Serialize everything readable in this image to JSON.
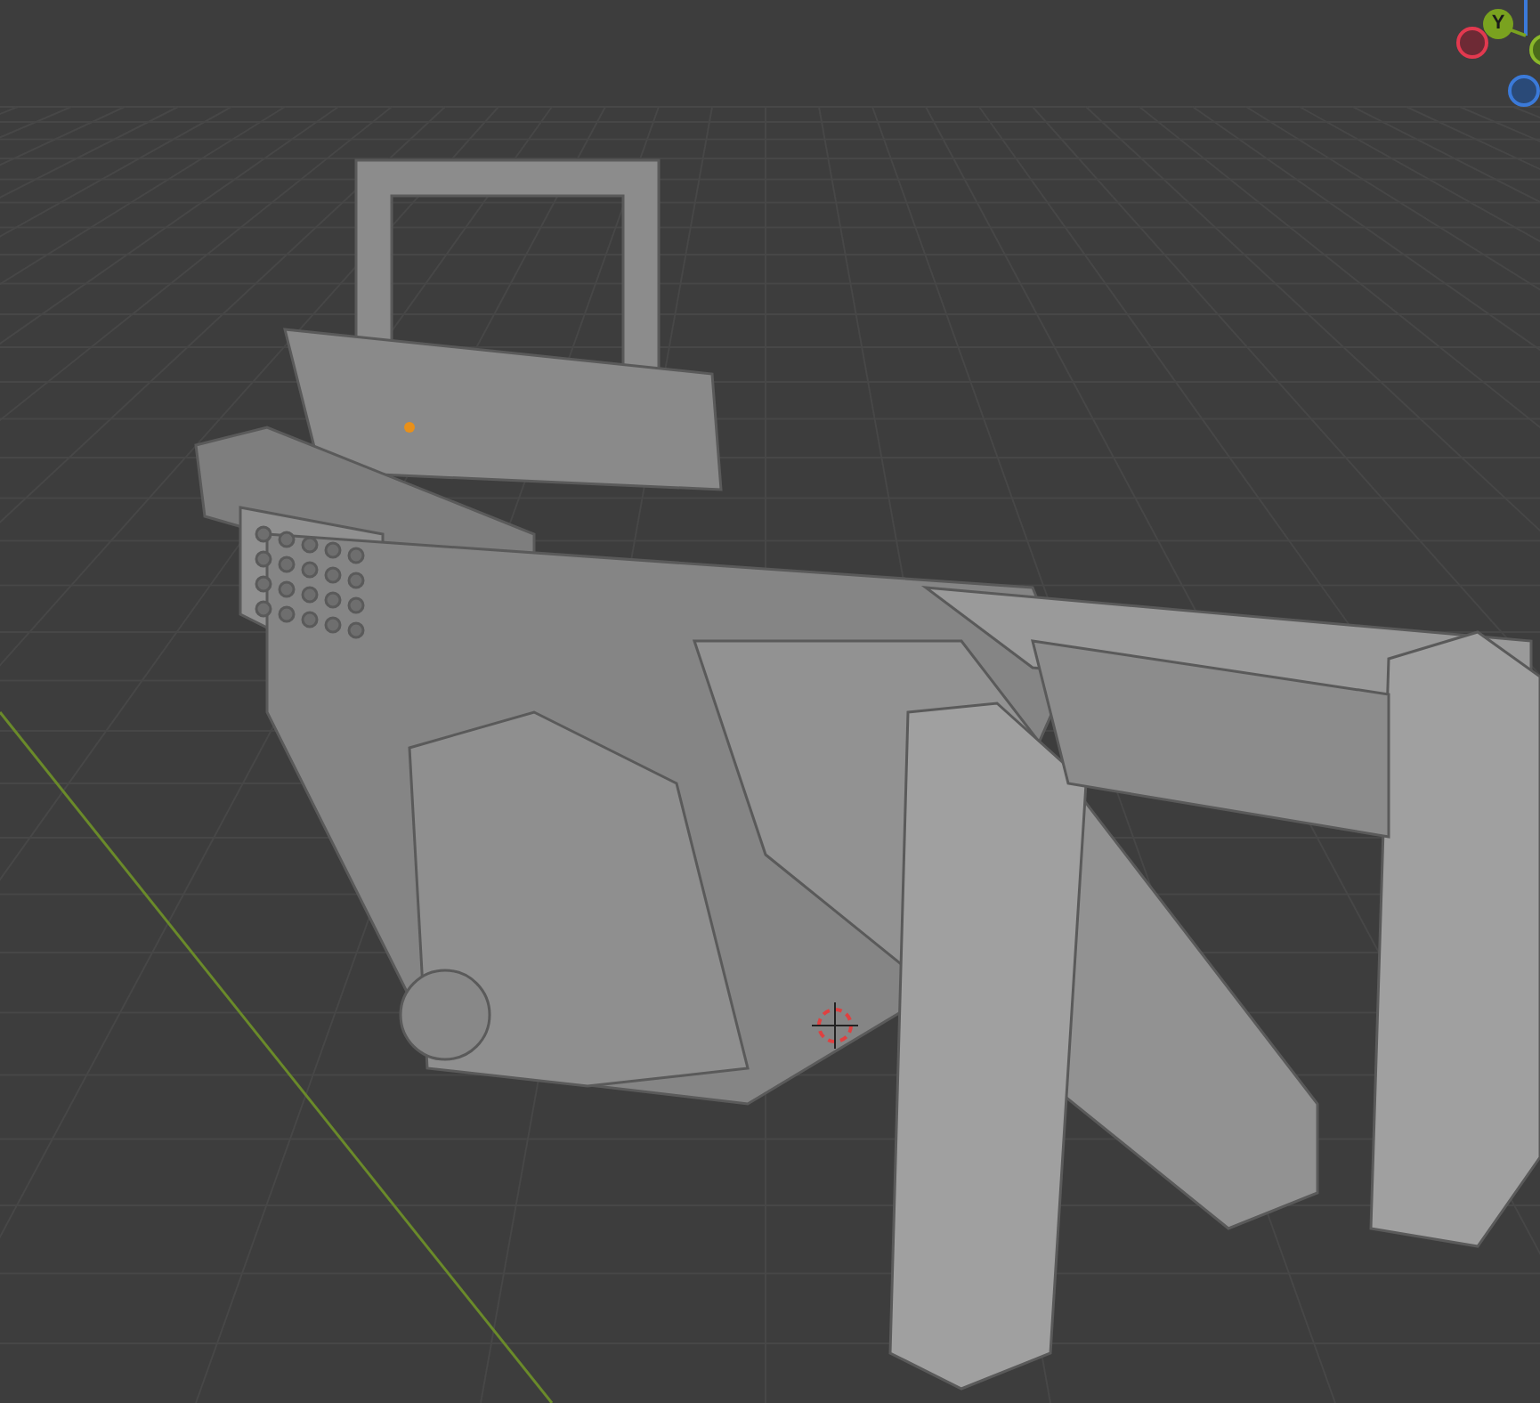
{
  "viewport": {
    "gizmo": {
      "axis_label": "Y"
    }
  }
}
